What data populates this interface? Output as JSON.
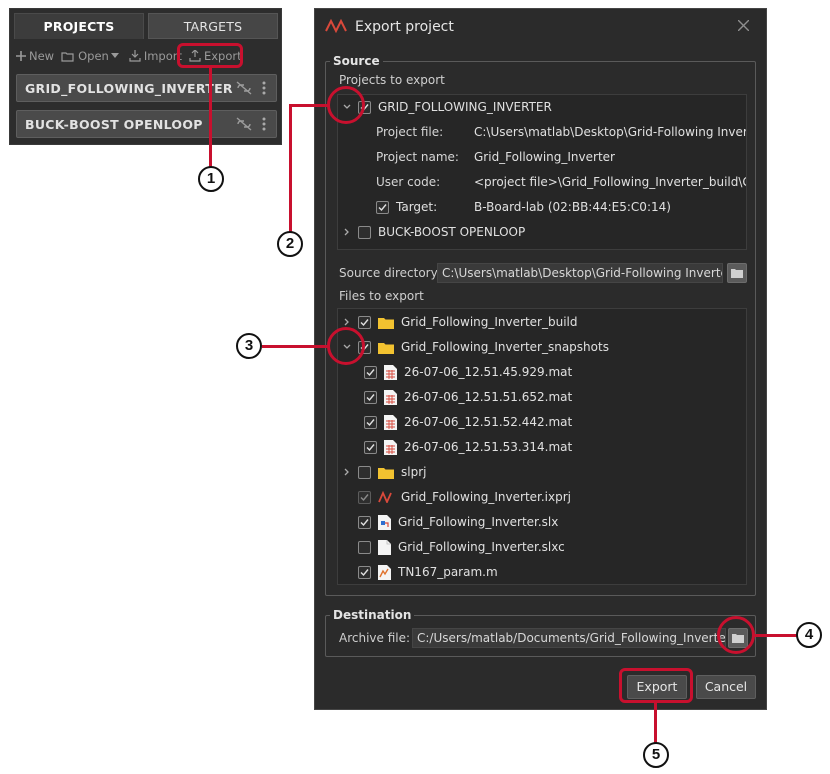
{
  "projects_panel": {
    "tabs": [
      {
        "label": "PROJECTS",
        "active": true
      },
      {
        "label": "TARGETS",
        "active": false
      }
    ],
    "toolbar": {
      "new_label": "New",
      "open_label": "Open",
      "import_label": "Import",
      "export_label": "Export"
    },
    "items": [
      {
        "label": "GRID_FOLLOWING_INVERTER"
      },
      {
        "label": "BUCK-BOOST OPENLOOP"
      }
    ]
  },
  "dialog": {
    "title": "Export project",
    "source": {
      "group_label": "Source",
      "projects_label": "Projects to export",
      "projects": [
        {
          "name": "GRID_FOLLOWING_INVERTER",
          "checked": true,
          "expanded": true
        },
        {
          "name": "BUCK-BOOST OPENLOOP",
          "checked": false,
          "expanded": false
        }
      ],
      "details": {
        "project_file_label": "Project file:",
        "project_file_value": "C:\\Users\\matlab\\Desktop\\Grid-Following Inverter\\...",
        "project_name_label": "Project name:",
        "project_name_value": "Grid_Following_Inverter",
        "user_code_label": "User code:",
        "user_code_value": "<project file>\\Grid_Following_Inverter_build\\Grid_F...",
        "target_label": "Target:",
        "target_value": "B-Board-lab (02:BB:44:E5:C0:14)"
      },
      "source_dir_label": "Source directory",
      "source_dir_value": "C:\\Users\\matlab\\Desktop\\Grid-Following Inverter",
      "files_label": "Files to export",
      "files": [
        {
          "name": "Grid_Following_Inverter_build",
          "icon": "folder-icon"
        },
        {
          "name": "Grid_Following_Inverter_snapshots",
          "icon": "folder-icon"
        },
        {
          "name": "26-07-06_12.51.45.929.mat",
          "icon": "mat-file-icon"
        },
        {
          "name": "26-07-06_12.51.51.652.mat",
          "icon": "mat-file-icon"
        },
        {
          "name": "26-07-06_12.51.52.442.mat",
          "icon": "mat-file-icon"
        },
        {
          "name": "26-07-06_12.51.53.314.mat",
          "icon": "mat-file-icon"
        },
        {
          "name": "slprj",
          "icon": "folder-icon"
        },
        {
          "name": "Grid_Following_Inverter.ixprj",
          "icon": "imperix-project-icon"
        },
        {
          "name": "Grid_Following_Inverter.slx",
          "icon": "simulink-file-icon"
        },
        {
          "name": "Grid_Following_Inverter.slxc",
          "icon": "blank-file-icon"
        },
        {
          "name": "TN167_param.m",
          "icon": "matlab-script-icon"
        }
      ]
    },
    "destination": {
      "group_label": "Destination",
      "archive_label": "Archive file:",
      "archive_value": "C:/Users/matlab/Documents/Grid_Following_Inverter.zip"
    },
    "buttons": {
      "export_label": "Export",
      "cancel_label": "Cancel"
    }
  },
  "annotations": [
    "1",
    "2",
    "3",
    "4",
    "5"
  ],
  "colors": {
    "annotation_red": "#c8102e",
    "panel_bg": "#2d2d2d",
    "dialog_bg": "#2b2b2b",
    "folder_yellow": "#f2c230"
  }
}
